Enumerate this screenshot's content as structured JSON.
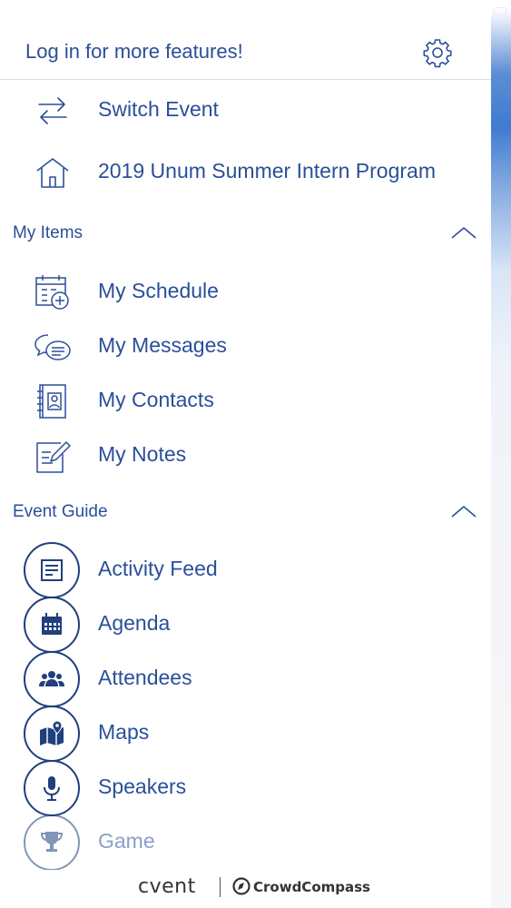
{
  "header": {
    "login_text": "Log in for more features!"
  },
  "nav": {
    "switch_event": "Switch Event",
    "event_name": "2019 Unum Summer Intern Program"
  },
  "my_items": {
    "title": "My Items",
    "items": [
      {
        "label": "My Schedule",
        "icon": "calendar-add-icon"
      },
      {
        "label": "My Messages",
        "icon": "chat-bubbles-icon"
      },
      {
        "label": "My Contacts",
        "icon": "contact-book-icon"
      },
      {
        "label": "My Notes",
        "icon": "note-pencil-icon"
      }
    ]
  },
  "event_guide": {
    "title": "Event Guide",
    "items": [
      {
        "label": "Activity Feed",
        "icon": "feed-icon"
      },
      {
        "label": "Agenda",
        "icon": "calendar-icon"
      },
      {
        "label": "Attendees",
        "icon": "people-icon"
      },
      {
        "label": "Maps",
        "icon": "map-icon"
      },
      {
        "label": "Speakers",
        "icon": "microphone-icon"
      },
      {
        "label": "Game",
        "icon": "trophy-icon"
      }
    ]
  },
  "footer": {
    "brand": "cvent",
    "partner": "CrowdCompass"
  },
  "colors": {
    "primary": "#2a4f9a",
    "icon_dark": "#1f3f7d",
    "divider": "#d9dde3"
  }
}
